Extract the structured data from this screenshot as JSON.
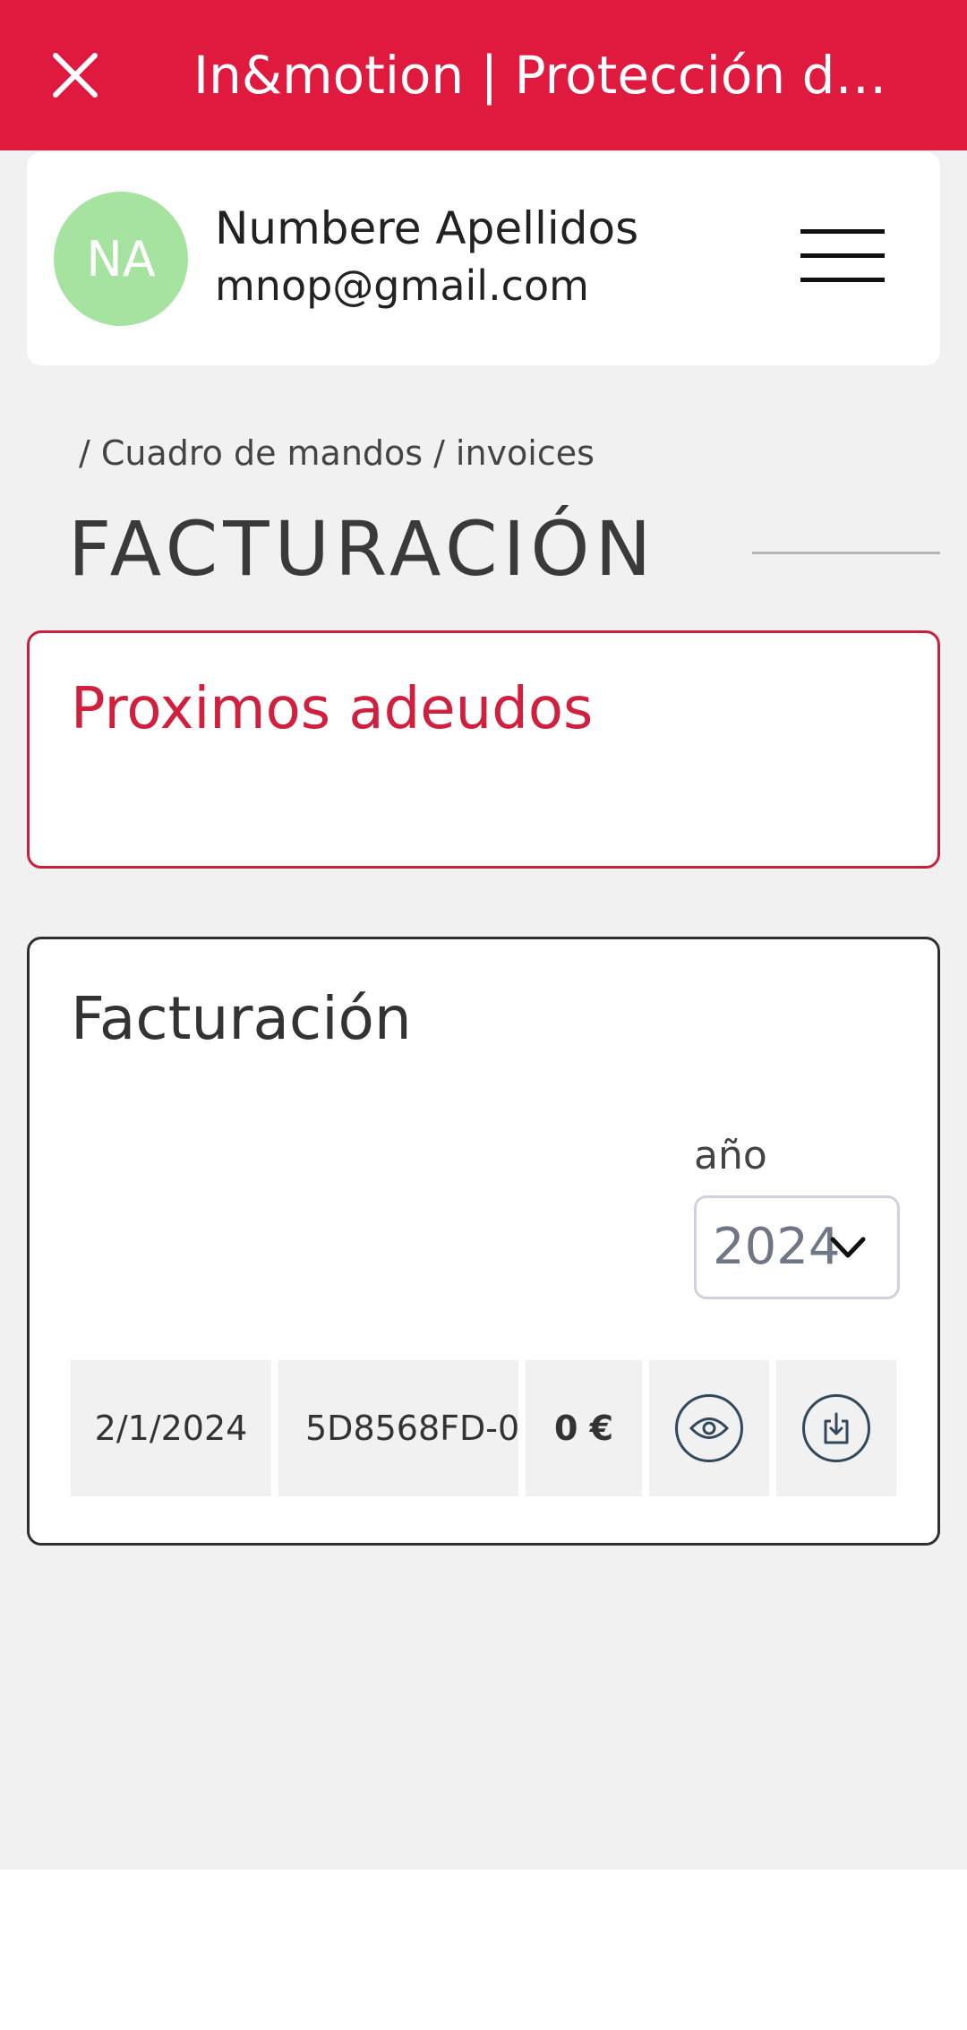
{
  "app_bar": {
    "title": "In&motion | Protección d…",
    "close_icon": "close-icon",
    "color": "#e0193f"
  },
  "profile": {
    "initials": "NA",
    "name": "Numbere Apellidos",
    "email": "mnop@gmail.com",
    "avatar_color": "#a6e3a1",
    "menu_icon": "hamburger-menu-icon"
  },
  "breadcrumb": {
    "separator": "/",
    "items": [
      "Cuadro de mandos",
      "invoices"
    ]
  },
  "page": {
    "title": "FACTURACIÓN"
  },
  "upcoming": {
    "title": "Proximos adeudos",
    "accent": "#d11f3e"
  },
  "billing": {
    "title": "Facturación",
    "year_label": "año",
    "year_selected": "2024",
    "invoices": [
      {
        "date": "2/1/2024",
        "code": "5D8568FD-0",
        "amount": "0 €",
        "view_icon": "eye-icon",
        "download_icon": "download-icon"
      }
    ]
  }
}
